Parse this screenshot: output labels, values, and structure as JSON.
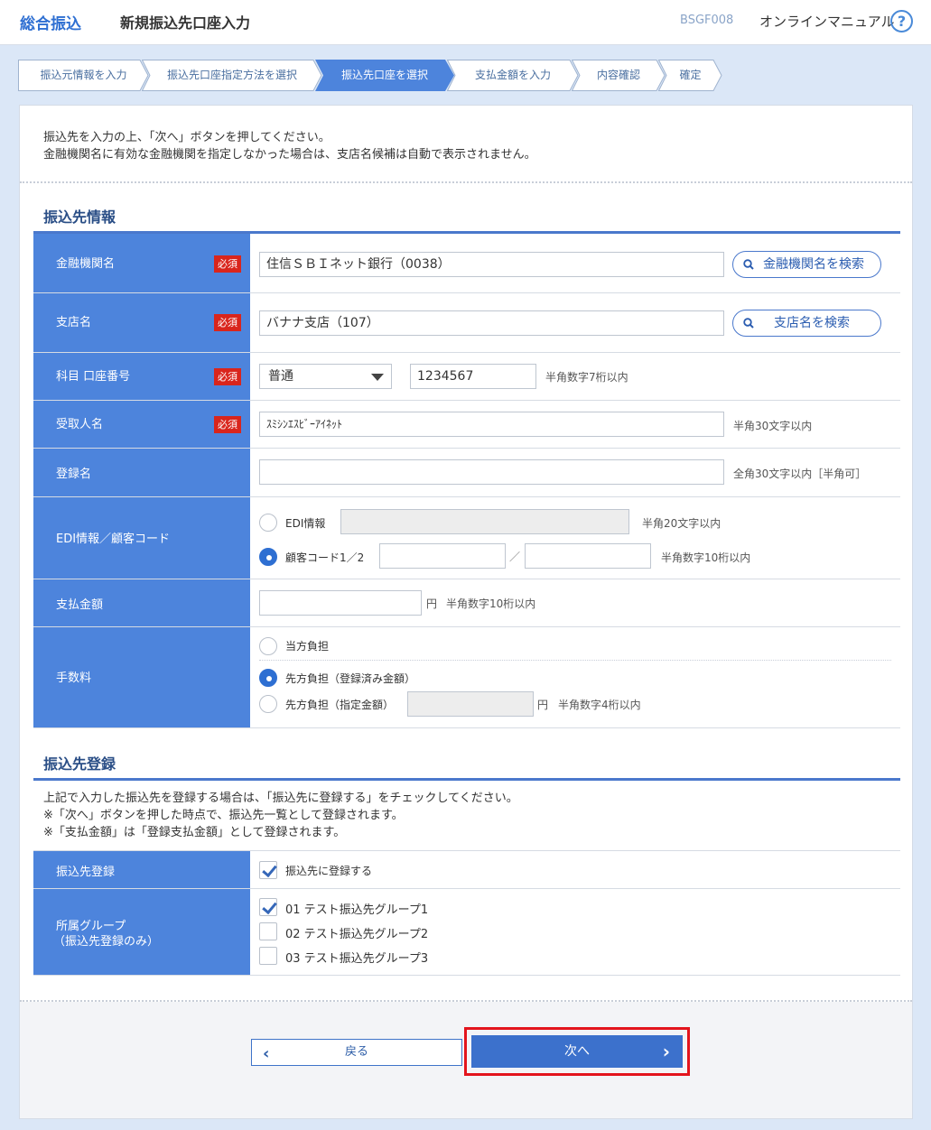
{
  "header": {
    "app_title": "総合振込",
    "page_title": "新規振込先口座入力",
    "screen_id": "BSGF008",
    "manual_link": "オンラインマニュアル",
    "help": "?"
  },
  "steps": [
    {
      "label": "振込元情報を入力",
      "active": false
    },
    {
      "label": "振込先口座指定方法を選択",
      "active": false
    },
    {
      "label": "振込先口座を選択",
      "active": true
    },
    {
      "label": "支払金額を入力",
      "active": false
    },
    {
      "label": "内容確認",
      "active": false
    },
    {
      "label": "確定",
      "active": false
    }
  ],
  "intro": {
    "line1": "振込先を入力の上、「次へ」ボタンを押してください。",
    "line2": "金融機関名に有効な金融機関を指定しなかった場合は、支店名候補は自動で表示されません。"
  },
  "payee_section": {
    "title": "振込先情報",
    "required": "必須",
    "bank": {
      "label": "金融機関名",
      "value": "住信ＳＢＩネット銀行（0038）",
      "search_label": "金融機関名を検索"
    },
    "branch": {
      "label": "支店名",
      "value": "バナナ支店（107）",
      "search_label": "支店名を検索"
    },
    "account": {
      "label": "科目 口座番号",
      "type_value": "普通",
      "number_value": "1234567",
      "hint": "半角数字7桁以内"
    },
    "recipient": {
      "label": "受取人名",
      "value": "ｽﾐｼﾝｴｽﾋﾞｰｱｲﾈｯﾄ",
      "hint": "半角30文字以内"
    },
    "reg_name": {
      "label": "登録名",
      "value": "",
      "hint": "全角30文字以内［半角可］"
    },
    "edi": {
      "label": "EDI情報／顧客コード",
      "edi_option": "EDI情報",
      "edi_hint": "半角20文字以内",
      "code_option": "顧客コード1／2",
      "separator": "／",
      "code_hint": "半角数字10桁以内",
      "selected": "code"
    },
    "amount": {
      "label": "支払金額",
      "value": "",
      "unit": "円",
      "hint": "半角数字10桁以内"
    },
    "fee": {
      "label": "手数料",
      "option1": "当方負担",
      "option2": "先方負担（登録済み金額）",
      "option3": "先方負担（指定金額）",
      "unit": "円",
      "hint": "半角数字4桁以内",
      "selected": 2
    }
  },
  "register_section": {
    "title": "振込先登録",
    "note1": "上記で入力した振込先を登録する場合は、「振込先に登録する」をチェックしてください。",
    "note2": "※「次へ」ボタンを押した時点で、振込先一覧として登録されます。",
    "note3": "※「支払金額」は「登録支払金額」として登録されます。",
    "register": {
      "label": "振込先登録",
      "option": "振込先に登録する",
      "checked": true
    },
    "groups": {
      "label1": "所属グループ",
      "label2": "（振込先登録のみ）",
      "items": [
        {
          "label": "01 テスト振込先グループ1",
          "checked": true
        },
        {
          "label": "02 テスト振込先グループ2",
          "checked": false
        },
        {
          "label": "03 テスト振込先グループ3",
          "checked": false
        }
      ]
    }
  },
  "buttons": {
    "back": "戻る",
    "next": "次へ"
  },
  "colors": {
    "accent": "#4d84dc",
    "required": "#d9251c",
    "highlight": "#e3141d"
  }
}
